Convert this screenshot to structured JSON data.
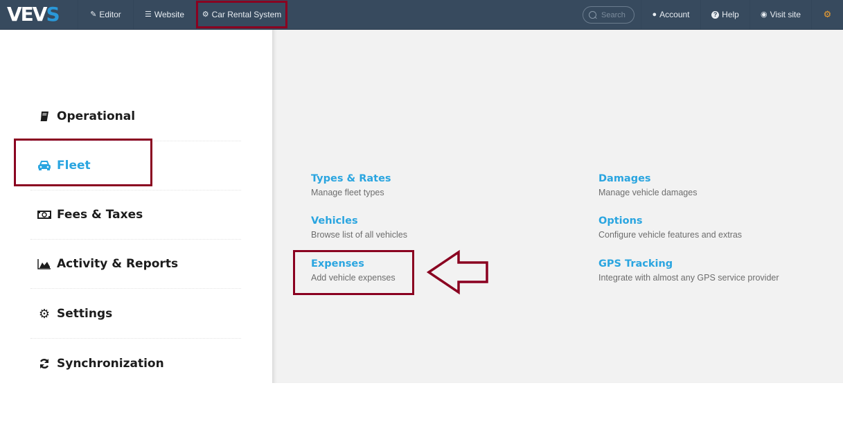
{
  "navbar": {
    "logo": {
      "main": "VEV",
      "accent": "S"
    },
    "items": [
      {
        "label": "Editor",
        "icon": "pencil-icon",
        "glyph": "✎"
      },
      {
        "label": "Website",
        "icon": "list-icon",
        "glyph": "☰"
      },
      {
        "label": "Car Rental System",
        "icon": "gear-icon",
        "glyph": "⚙"
      }
    ],
    "search": {
      "placeholder": "Search",
      "value": ""
    },
    "right_items": [
      {
        "label": "Account",
        "icon": "user-icon",
        "glyph": "👤"
      },
      {
        "label": "Help",
        "icon": "question-circle-icon",
        "glyph": "?"
      },
      {
        "label": "Visit site",
        "icon": "eye-icon",
        "glyph": "👁"
      }
    ],
    "settings_icon": {
      "icon": "gear-icon",
      "glyph": "⚙",
      "color": "#f0a030"
    },
    "background": "#374a5e"
  },
  "sidebar": {
    "items": [
      {
        "label": "Operational",
        "icon": "book-icon",
        "glyph": "📕",
        "active": false
      },
      {
        "label": "Fleet",
        "icon": "car-icon",
        "glyph": "🚘",
        "active": true
      },
      {
        "label": "Fees & Taxes",
        "icon": "money-icon",
        "glyph": "💵",
        "active": false
      },
      {
        "label": "Activity & Reports",
        "icon": "area-chart-icon",
        "glyph": "▲",
        "active": false
      },
      {
        "label": "Settings",
        "icon": "gear-icon",
        "glyph": "⚙",
        "active": false
      },
      {
        "label": "Synchronization",
        "icon": "refresh-icon",
        "glyph": "⟳",
        "active": false
      }
    ],
    "active_color": "#2aa5e0"
  },
  "content": {
    "left_column": [
      {
        "title": "Types & Rates",
        "description": "Manage fleet types"
      },
      {
        "title": "Vehicles",
        "description": "Browse list of all vehicles"
      },
      {
        "title": "Expenses",
        "description": "Add vehicle expenses"
      }
    ],
    "right_column": [
      {
        "title": "Damages",
        "description": "Manage vehicle damages"
      },
      {
        "title": "Options",
        "description": "Configure vehicle features and extras"
      },
      {
        "title": "GPS Tracking",
        "description": "Integrate with almost any GPS service provider"
      }
    ],
    "link_color": "#2aa5e0"
  },
  "annotations": {
    "highlight_color": "#8a0020",
    "highlighted": [
      "Car Rental System",
      "Fleet",
      "Expenses"
    ],
    "arrow_points_to": "Expenses"
  }
}
